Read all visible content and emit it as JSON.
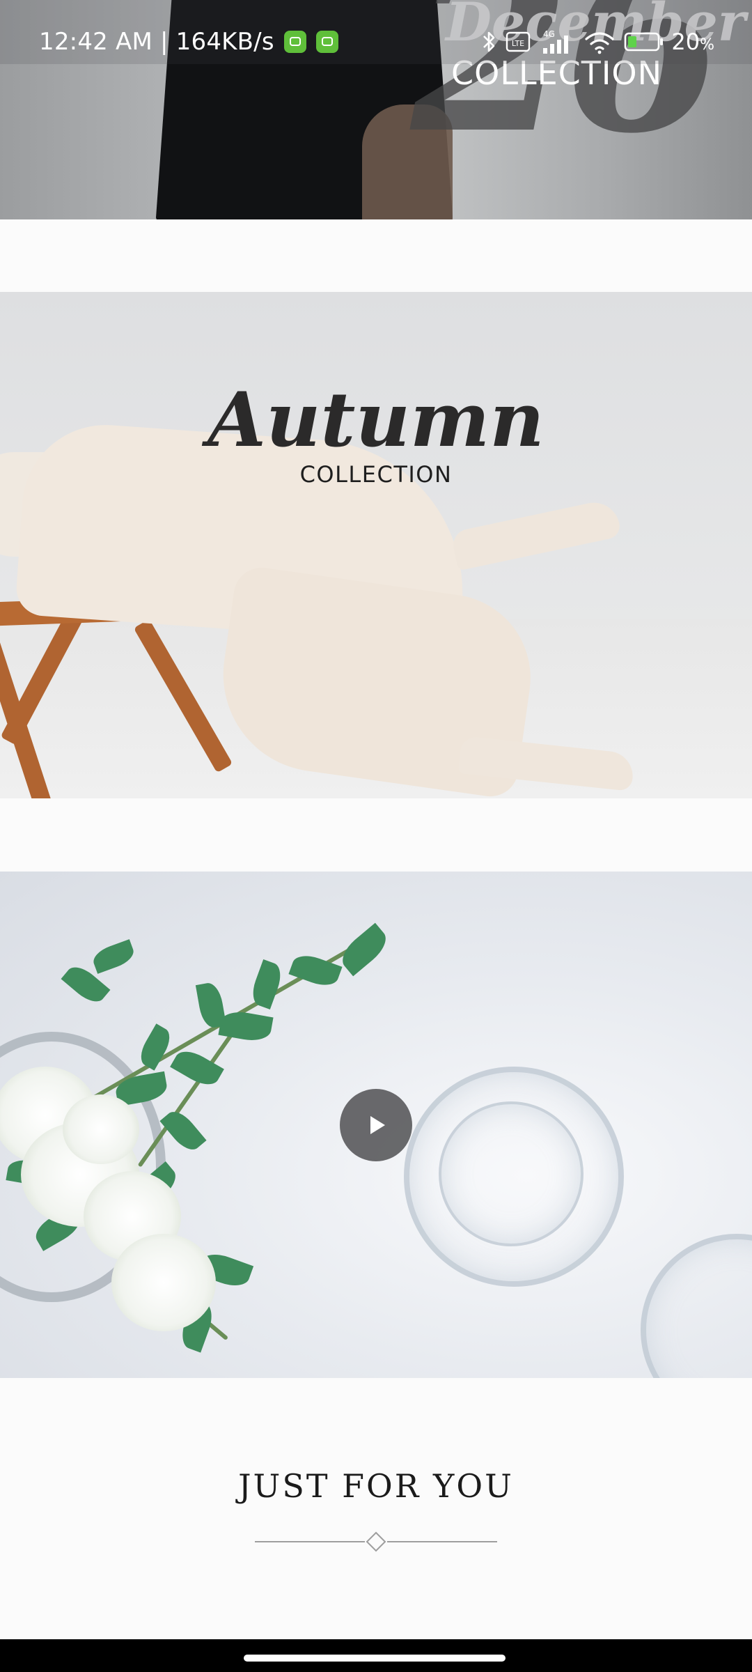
{
  "status_bar": {
    "time_speed": "12:42 AM | 164KB/s",
    "battery_percent": "20",
    "battery_unit": "%",
    "network_label": "4G",
    "lte_label": "LTE",
    "icons": [
      "app-badge-icon",
      "bluetooth-icon",
      "volte-icon",
      "signal-icon",
      "wifi-icon",
      "battery-icon"
    ]
  },
  "banners": {
    "top": {
      "big_number": "26",
      "title": "December",
      "subtitle": "COLLECTION"
    },
    "autumn": {
      "title": "Autumn",
      "subtitle": "COLLECTION"
    },
    "video": {
      "icon": "play-icon"
    }
  },
  "section": {
    "title": "JUST FOR YOU"
  },
  "colors": {
    "background": "#fbfbfb",
    "text_dark": "#1b1b1b",
    "divider": "#9e9e9e",
    "play_button": "#505052",
    "nav_bar": "#000000"
  }
}
